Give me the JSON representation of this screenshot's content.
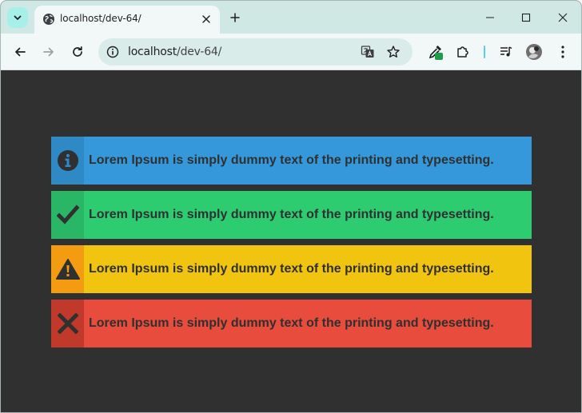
{
  "browser": {
    "tab_title": "localhost/dev-64/",
    "url_host": "localhost",
    "url_path": "/dev-64/"
  },
  "colors": {
    "page_bg": "#303030",
    "info": "#3498db",
    "info_dark": "#2f89c5",
    "success": "#2ecc71",
    "success_dark": "#29b765",
    "warning": "#f1c40f",
    "warning_dark": "#f39c12",
    "error": "#e74c3c",
    "error_dark": "#c0392b"
  },
  "alerts": [
    {
      "type": "info",
      "icon": "info-circle-icon",
      "text": "Lorem Ipsum is simply dummy text of the printing and typesetting."
    },
    {
      "type": "success",
      "icon": "checkmark-icon",
      "text": "Lorem Ipsum is simply dummy text of the printing and typesetting."
    },
    {
      "type": "warning",
      "icon": "warning-triangle-icon",
      "text": "Lorem Ipsum is simply dummy text of the printing and typesetting."
    },
    {
      "type": "error",
      "icon": "cross-icon",
      "text": "Lorem Ipsum is simply dummy text of the printing and typesetting."
    }
  ]
}
